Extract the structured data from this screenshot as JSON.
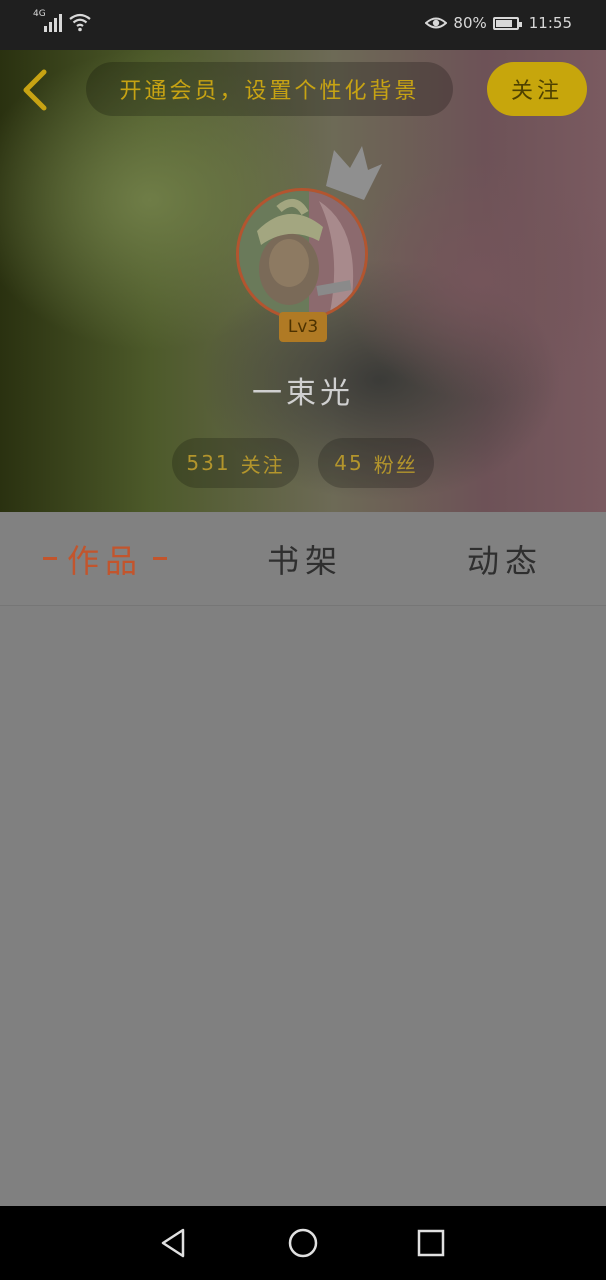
{
  "status_bar": {
    "network_type": "4G",
    "battery_percent": "80%",
    "battery_level": 0.8,
    "time": "11:55",
    "icons": [
      "signal-icon",
      "wifi-icon",
      "eye-comfort-icon",
      "battery-icon"
    ]
  },
  "header": {
    "back_icon": "chevron-left-icon",
    "vip_banner": "开通会员，设置个性化背景",
    "follow_label": "关注"
  },
  "profile": {
    "crown_icon": "crown-icon",
    "level": "Lv3",
    "username": "一束光",
    "following_count": "531",
    "following_label": "关注",
    "fans_count": "45",
    "fans_label": "粉丝"
  },
  "tabs": [
    {
      "label": "作品",
      "active": true
    },
    {
      "label": "书架",
      "active": false
    },
    {
      "label": "动态",
      "active": false
    }
  ],
  "colors": {
    "accent": "#c2552d",
    "follow_button": "#c7a60c",
    "overlay_gray": "#808080"
  },
  "nav_bar": {
    "icons": [
      "back-triangle-icon",
      "home-circle-icon",
      "recents-square-icon"
    ]
  }
}
